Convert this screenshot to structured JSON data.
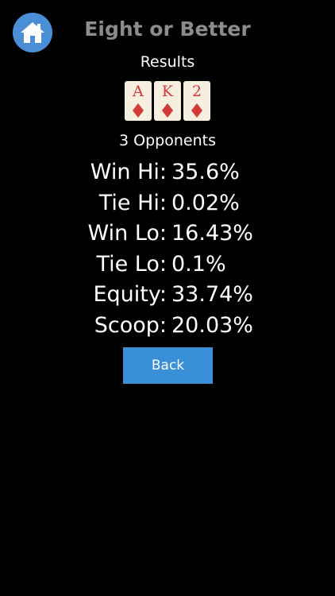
{
  "header": {
    "title": "Eight or Better",
    "subtitle": "Results"
  },
  "colors": {
    "home_button": "#4a8fd6",
    "title": "#8c8c8c",
    "card_face": "#f6efe0",
    "card_red": "#d23a36",
    "back_button": "#3a8fd9"
  },
  "hand": {
    "cards": [
      {
        "rank": "A",
        "suit": "diamond-icon"
      },
      {
        "rank": "K",
        "suit": "diamond-icon"
      },
      {
        "rank": "2",
        "suit": "diamond-icon"
      }
    ]
  },
  "opponents": "3 Opponents",
  "stats": [
    {
      "label": "Win Hi:",
      "value": "35.6%"
    },
    {
      "label": "Tie Hi:",
      "value": "0.02%"
    },
    {
      "label": "Win Lo:",
      "value": "16.43%"
    },
    {
      "label": "Tie Lo:",
      "value": "0.1%"
    },
    {
      "label": "Equity:",
      "value": "33.74%"
    },
    {
      "label": "Scoop:",
      "value": "20.03%"
    }
  ],
  "actions": {
    "back_label": "Back"
  },
  "icons": {
    "home": "home-icon"
  }
}
